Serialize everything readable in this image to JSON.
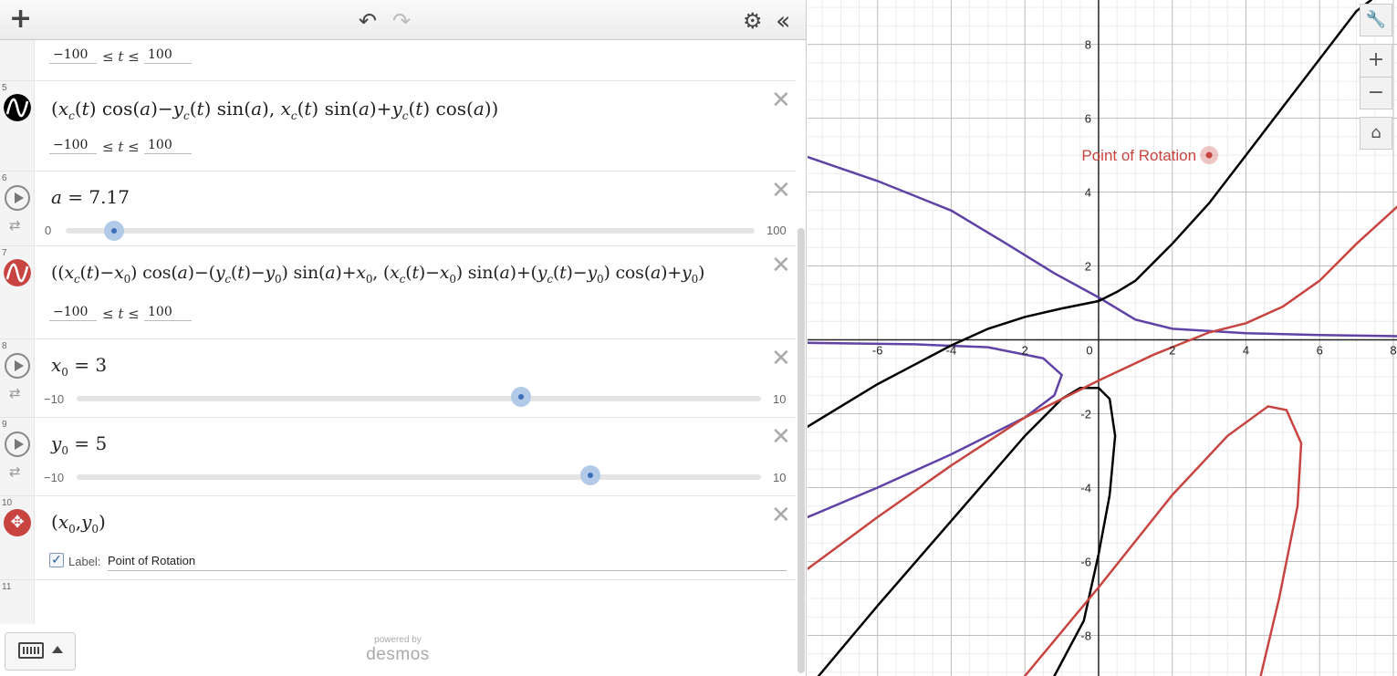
{
  "toolbar": {
    "add_icon": "plus-icon",
    "undo_icon": "undo-icon",
    "redo_icon": "redo-icon",
    "settings_icon": "gear-icon",
    "collapse_icon": "double-chevron-left-icon"
  },
  "expressions": [
    {
      "index": "",
      "lower": "−100",
      "upper": "100"
    },
    {
      "index": "5",
      "color": "#000000",
      "lower": "−100",
      "upper": "100"
    },
    {
      "index": "6",
      "variable": "a",
      "value": "7.17",
      "min": "0",
      "max": "100",
      "fraction": 0.0717
    },
    {
      "index": "7",
      "color": "#c74440",
      "lower": "−100",
      "upper": "100"
    },
    {
      "index": "8",
      "variable": "x",
      "value": "3",
      "min": "−10",
      "max": "10",
      "fraction": 0.65
    },
    {
      "index": "9",
      "variable": "y",
      "value": "5",
      "min": "−10",
      "max": "10",
      "fraction": 0.75
    },
    {
      "index": "10",
      "color": "#c74440",
      "label_caption": "Label:",
      "label_value": "Point of Rotation",
      "checked": true
    },
    {
      "index": "11"
    }
  ],
  "footer": {
    "powered": "powered by",
    "brand": "desmos"
  },
  "graph": {
    "point_label": "Point of Rotation",
    "x_range": [
      -7.9,
      8.1
    ],
    "y_range": [
      -9.1,
      9.2
    ],
    "x_ticks": [
      "-6",
      "-4",
      "2",
      "0",
      "2",
      "4",
      "6",
      "8"
    ],
    "y_ticks": [
      "8",
      "6",
      "4",
      "2",
      "-2",
      "-4",
      "-6",
      "-8"
    ],
    "colors": {
      "black": "#000000",
      "red": "#c74440",
      "purple": "#6042a6"
    }
  }
}
